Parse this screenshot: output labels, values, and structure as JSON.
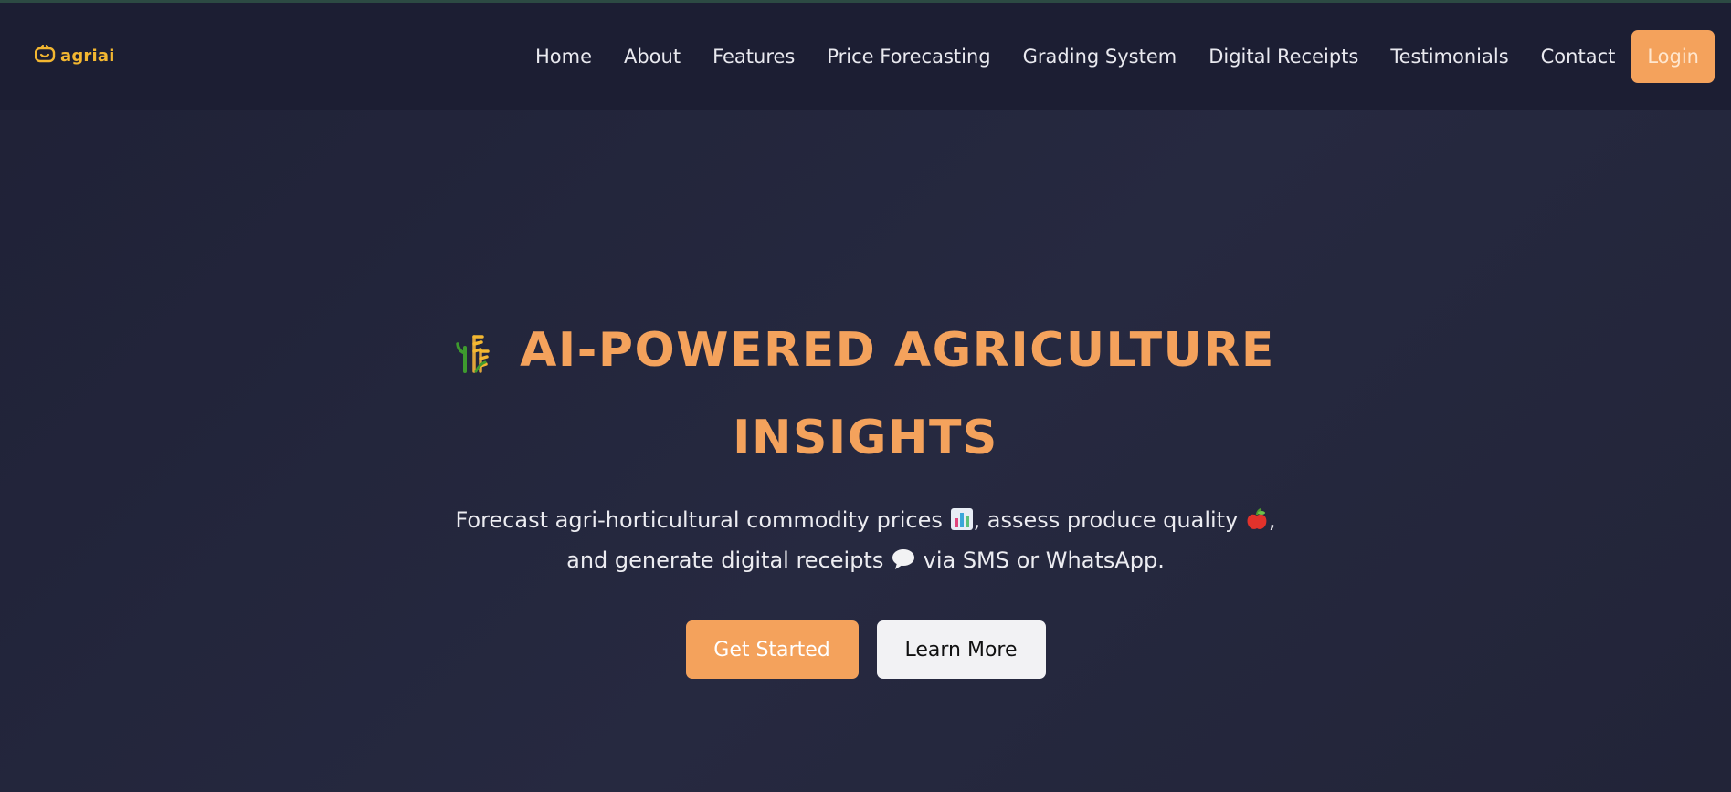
{
  "brand": {
    "name": "agriai",
    "color": "#f3b731"
  },
  "nav": {
    "links": [
      "Home",
      "About",
      "Features",
      "Price Forecasting",
      "Grading System",
      "Digital Receipts",
      "Testimonials",
      "Contact"
    ],
    "login_label": "Login"
  },
  "hero": {
    "title_icon": "sheaf-of-rice-icon",
    "title_line1": "AI-POWERED AGRICULTURE",
    "title_line2": "INSIGHTS",
    "sub_part1": "Forecast agri-horticultural commodity prices ",
    "sub_icon1": "bar-chart-icon",
    "sub_part2": ", assess produce quality ",
    "sub_icon2": "red-apple-icon",
    "sub_part3": ",",
    "sub_part4": "and generate digital receipts ",
    "sub_icon3": "speech-bubble-icon",
    "sub_part5": " via SMS or WhatsApp.",
    "primary_button": "Get Started",
    "secondary_button": "Learn More"
  },
  "colors": {
    "accent": "#f4a25c",
    "background": "#22243a",
    "navbar": "#1c1e33"
  }
}
